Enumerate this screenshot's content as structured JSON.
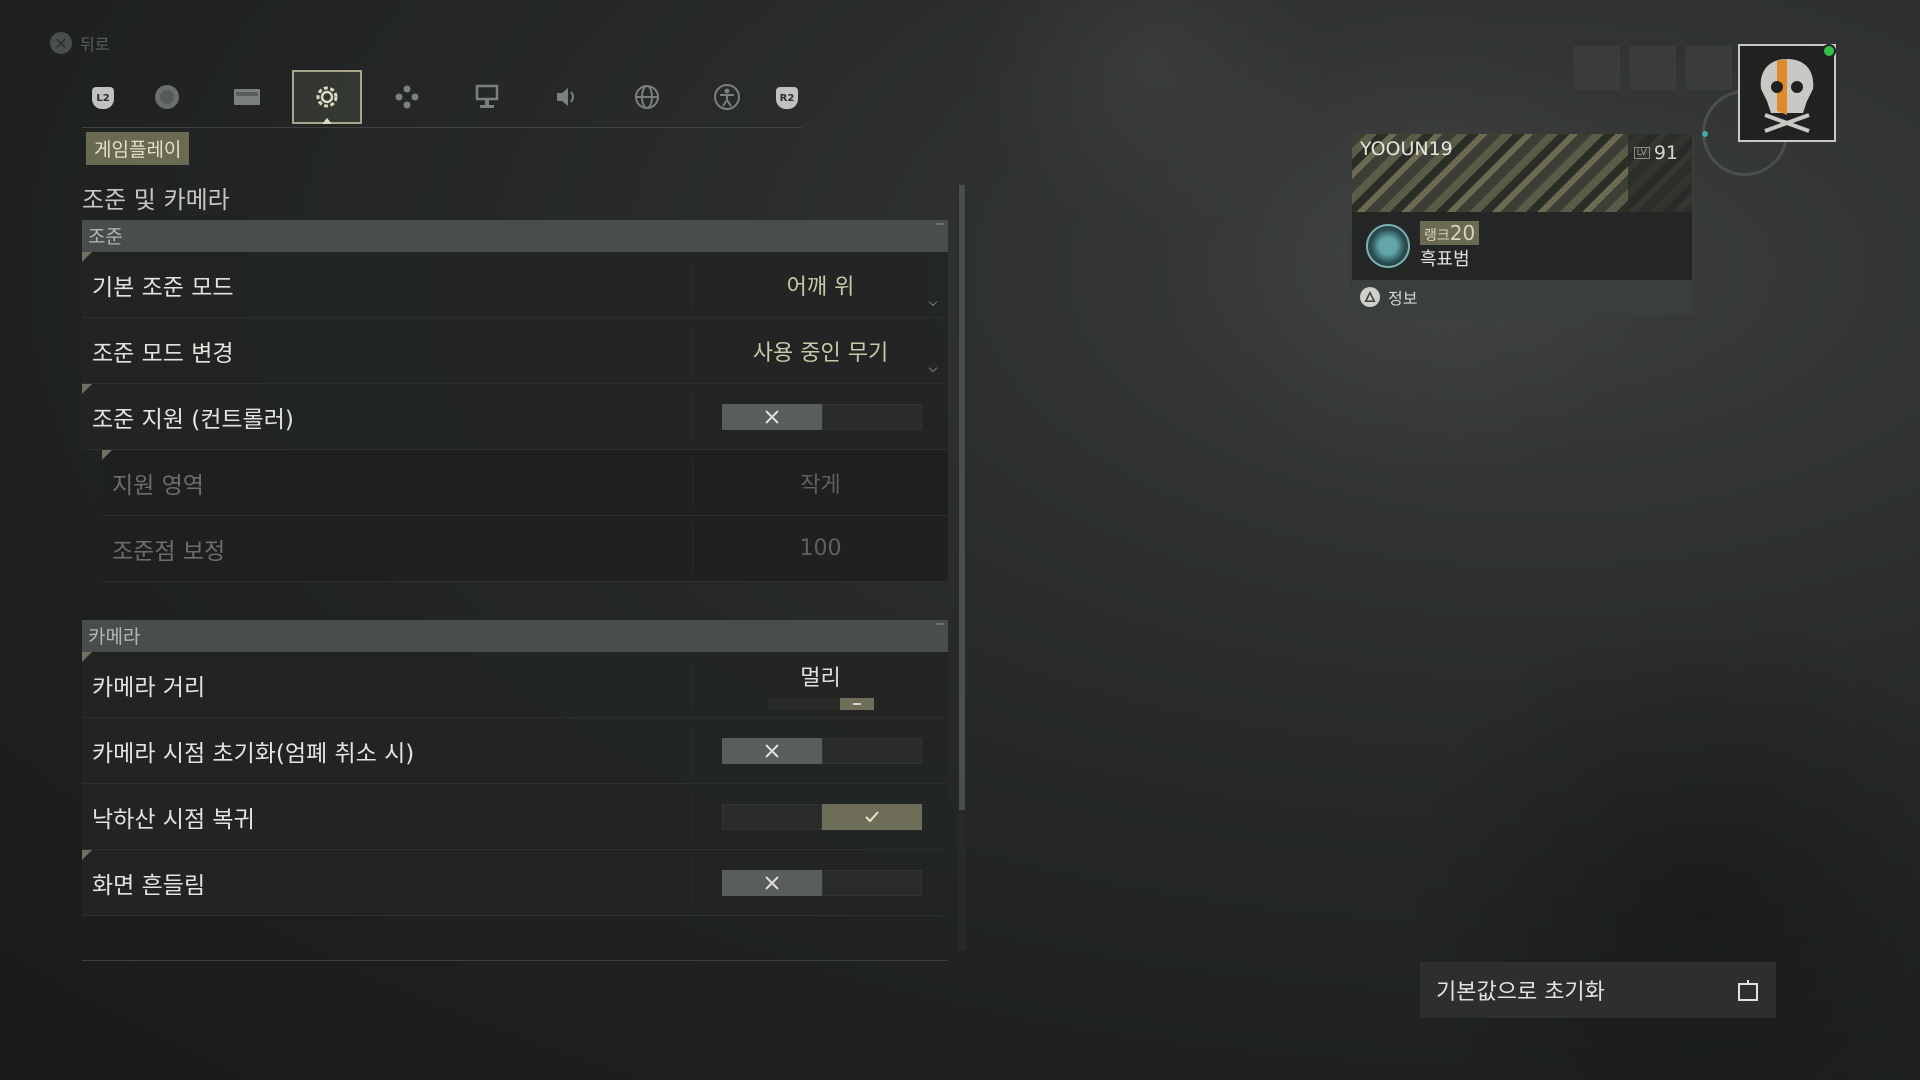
{
  "back_label": "뒤로",
  "tabs": [
    {
      "name": "tab-player",
      "icon": "player-icon"
    },
    {
      "name": "tab-display",
      "icon": "display-icon"
    },
    {
      "name": "tab-gameplay",
      "icon": "gear-icon",
      "active": true
    },
    {
      "name": "tab-controls",
      "icon": "controls-icon"
    },
    {
      "name": "tab-interface",
      "icon": "interface-icon"
    },
    {
      "name": "tab-audio",
      "icon": "speaker-icon"
    },
    {
      "name": "tab-language",
      "icon": "globe-icon"
    },
    {
      "name": "tab-accessibility",
      "icon": "accessibility-icon"
    }
  ],
  "bumpers": {
    "left": "L2",
    "right": "R2"
  },
  "section_tag": "게임플레이",
  "page_title": "조준 및 카메라",
  "aiming": {
    "header": "조준",
    "rows": [
      {
        "label": "기본 조준 모드",
        "value": "어깨 위"
      },
      {
        "label": "조준 모드 변경",
        "value": "사용 중인 무기"
      },
      {
        "label": "조준 지원 (컨트롤러)",
        "toggle": "off"
      },
      {
        "label": "지원 영역",
        "value": "작게"
      },
      {
        "label": "조준점 보정",
        "value": "100"
      }
    ]
  },
  "camera": {
    "header": "카메라",
    "rows": [
      {
        "label": "카메라 거리",
        "value": "멀리"
      },
      {
        "label": "카메라 시점 초기화(엄폐 취소 시)",
        "toggle": "off"
      },
      {
        "label": "낙하산 시점 복귀",
        "toggle": "on"
      },
      {
        "label": "화면 흔들림",
        "toggle": "off"
      }
    ]
  },
  "profile": {
    "username": "YOOUN19",
    "level": "91",
    "rank_prefix": "랭크",
    "rank_number": "20",
    "rank_name": "흑표범",
    "info_label": "정보",
    "online_color": "#35c24a"
  },
  "reset_button": "기본값으로 초기화",
  "accent_color": "#6a6a52"
}
